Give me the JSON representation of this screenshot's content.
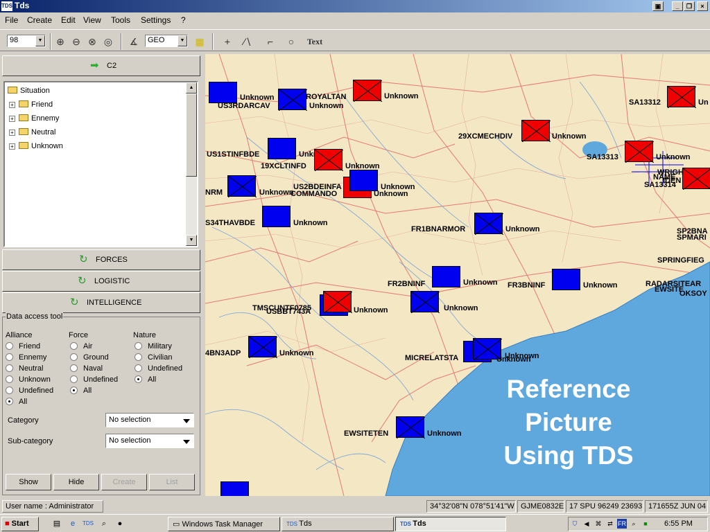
{
  "window": {
    "title": "Tds",
    "icon_text": "TDS"
  },
  "menu": [
    "File",
    "Create",
    "Edit",
    "View",
    "Tools",
    "Settings",
    "?"
  ],
  "toolbar": {
    "zoom_value": "98",
    "coord_system": "GEO",
    "text_tool": "Text"
  },
  "left_panel": {
    "c2_label": "C2",
    "tree": {
      "root": "Situation",
      "children": [
        "Friend",
        "Ennemy",
        "Neutral",
        "Unknown"
      ]
    },
    "forces_label": "FORCES",
    "logistic_label": "LOGISTIC",
    "intelligence_label": "INTELLIGENCE"
  },
  "data_access": {
    "title": "Data access tool",
    "alliance": {
      "label": "Alliance",
      "options": [
        "Friend",
        "Ennemy",
        "Neutral",
        "Unknown",
        "Undefined",
        "All"
      ],
      "selected": "All"
    },
    "force": {
      "label": "Force",
      "options": [
        "Air",
        "Ground",
        "Naval",
        "Undefined",
        "All"
      ],
      "selected": "All"
    },
    "nature": {
      "label": "Nature",
      "options": [
        "Military",
        "Civilian",
        "Undefined",
        "All"
      ],
      "selected": "All"
    },
    "category": {
      "label": "Category",
      "value": "No selection"
    },
    "subcategory": {
      "label": "Sub-category",
      "value": "No selection"
    },
    "buttons": {
      "show": "Show",
      "hide": "Hide",
      "create": "Create",
      "list": "List"
    }
  },
  "map": {
    "overlay_lines": [
      "Reference",
      "Picture",
      "Using TDS"
    ],
    "units": [
      {
        "name": "US3RDARCAV",
        "status": "Unknown",
        "color": "blue"
      },
      {
        "name": "ROYALTAN",
        "status": "Unknown",
        "color": "blue"
      },
      {
        "name": "",
        "status": "Unknown",
        "color": "red"
      },
      {
        "name": "SA13312",
        "status": "Un",
        "color": "red"
      },
      {
        "name": "29XCMECHDIV",
        "status": "Unknown",
        "color": "red"
      },
      {
        "name": "US1STINFBDE",
        "status": "Unknown",
        "color": "blue"
      },
      {
        "name": "19XCLTINFD",
        "status": "Unknown",
        "color": "red"
      },
      {
        "name": "SA13313",
        "status": "Unknown",
        "color": "red"
      },
      {
        "name": "SA13314",
        "status": "",
        "color": "red"
      },
      {
        "name": "US2BDEINFA",
        "status": "Unknown",
        "color": "blue"
      },
      {
        "name": "COMMANDO",
        "status": "Unknown",
        "color": "red"
      },
      {
        "name": "NRM",
        "status": "Unknown",
        "color": "blue"
      },
      {
        "name": "S34THAVBDE",
        "status": "Unknown",
        "color": "blue"
      },
      {
        "name": "FR1BNARMOR",
        "status": "Unknown",
        "color": "blue"
      },
      {
        "name": "FR2BNINF",
        "status": "Unknown",
        "color": "blue"
      },
      {
        "name": "FR3BNINF",
        "status": "Unknown",
        "color": "blue"
      },
      {
        "name": "USBBT743A",
        "status": "Unknown",
        "color": "red"
      },
      {
        "name": "TMSCUNTF0785",
        "status": "",
        "color": "blue"
      },
      {
        "name": "",
        "status": "Unknown",
        "color": "blue"
      },
      {
        "name": "4BN3ADP",
        "status": "Unknown",
        "color": "blue"
      },
      {
        "name": "MICRELATSTA",
        "status": "Unknown",
        "color": "blue"
      },
      {
        "name": "",
        "status": "Unknown",
        "color": "blue"
      },
      {
        "name": "EWSITETEN",
        "status": "Unknown",
        "color": "blue"
      },
      {
        "name": "",
        "status": "",
        "color": "blue"
      }
    ],
    "edge_labels": [
      "SP2BNA",
      "SPMARI",
      "SPRINGFIEG",
      "RADARSITEAR",
      "EWSITE",
      "OKSOY",
      "WRIGH",
      "NAME",
      "IDEN"
    ]
  },
  "status": {
    "user": "User name : Administrator",
    "coords": "34°32'08\"N 078°51'41\"W",
    "grid": "GJME0832E",
    "utm": "17 SPU 96249 23693",
    "dtg": "171655Z JUN 04"
  },
  "taskbar": {
    "start": "Start",
    "tasks": [
      {
        "label": "Windows Task Manager",
        "active": false
      },
      {
        "label": "Tds",
        "active": false
      },
      {
        "label": "Tds",
        "active": true
      }
    ],
    "time": "6:55 PM",
    "lang": "FR"
  }
}
